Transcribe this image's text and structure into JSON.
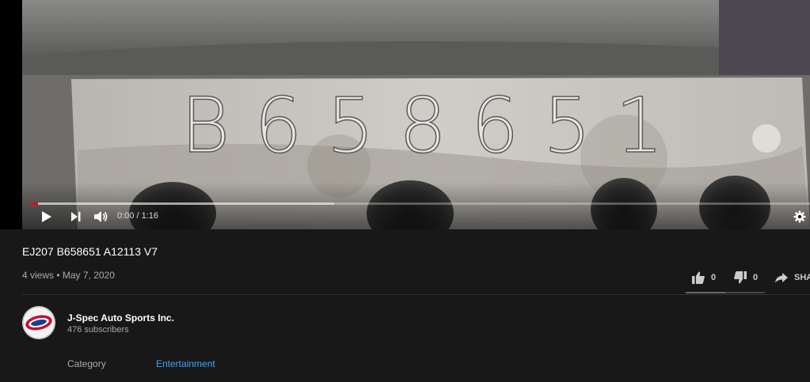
{
  "player": {
    "time_current": "0:00",
    "time_total": "1:16",
    "time_display": "0:00 / 1:16",
    "progress_played": 0.01,
    "progress_loaded": 0.39,
    "stamped_text": "B 6 5 8 6 5 1"
  },
  "video": {
    "title": "EJ207 B658651 A12113 V7",
    "views": "4 views",
    "separator": "•",
    "date": "May 7, 2020",
    "meta_line": "4 views • May 7, 2020"
  },
  "actions": {
    "like_count": "0",
    "dislike_count": "0",
    "share_label": "SHA"
  },
  "channel": {
    "name": "J-Spec Auto Sports Inc.",
    "subscribers": "476 subscribers",
    "avatar_text": "J-SPEC AUTO"
  },
  "details": {
    "category_label": "Category",
    "category_value": "Entertainment"
  },
  "colors": {
    "background": "#181818",
    "progress_played": "#ff0000",
    "link": "#3ea6ff",
    "secondary_text": "#aaaaaa"
  }
}
